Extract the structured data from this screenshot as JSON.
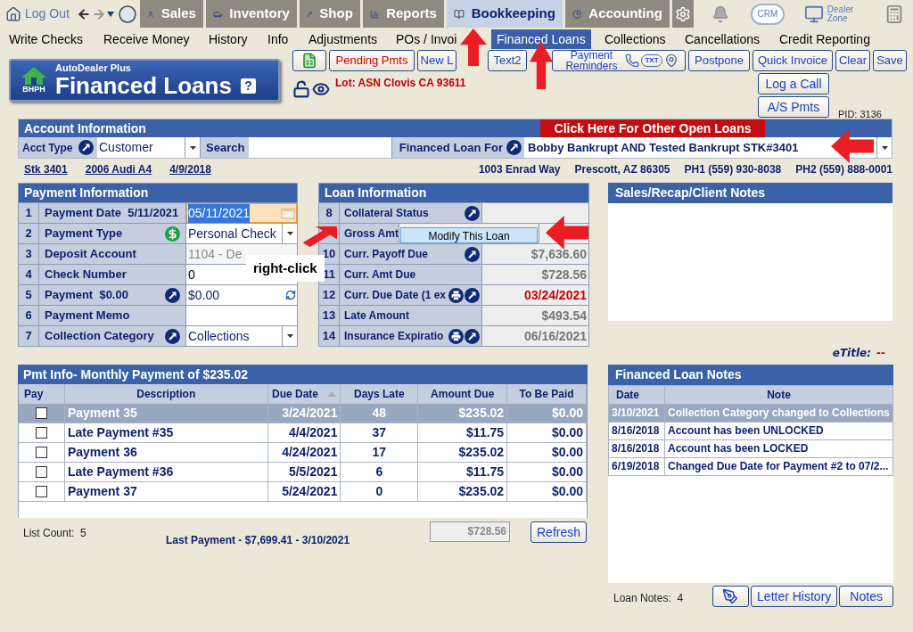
{
  "top_nav": {
    "logout": "Log Out",
    "modules": [
      {
        "label": "Sales",
        "selected": false
      },
      {
        "label": "Inventory",
        "selected": false
      },
      {
        "label": "Shop",
        "selected": false
      },
      {
        "label": "Reports",
        "selected": false
      },
      {
        "label": "Bookkeeping",
        "selected": true
      },
      {
        "label": "Accounting",
        "selected": false
      }
    ],
    "crm": "CRM",
    "dealer_zone": "Dealer Zone"
  },
  "sub_nav": [
    {
      "label": "Write Checks",
      "selected": false
    },
    {
      "label": "Receive Money",
      "selected": false
    },
    {
      "label": "History",
      "selected": false
    },
    {
      "label": "Info",
      "selected": false
    },
    {
      "label": "Adjustments",
      "selected": false
    },
    {
      "label": "POs / Invoi",
      "selected": false
    },
    {
      "label": "Financed Loans",
      "selected": true
    },
    {
      "label": "Collections",
      "selected": false
    },
    {
      "label": "Cancellations",
      "selected": false
    },
    {
      "label": "Credit Reporting",
      "selected": false
    }
  ],
  "header": {
    "brand": "AutoDealer Plus",
    "title": "Financed Loans",
    "help": "?",
    "logo_text": "BHPH",
    "lot": "Lot: ASN Clovis CA 93611"
  },
  "toolbar": [
    {
      "label": "Pending Pmts",
      "highlight": true
    },
    {
      "label": "New L",
      "highlight": false
    },
    {
      "label": "Text2",
      "highlight": false
    },
    {
      "label": "Payment Reminders",
      "highlight": false
    },
    {
      "label": "Postpone",
      "highlight": false
    },
    {
      "label": "Quick Invoice",
      "highlight": false
    },
    {
      "label": "Clear",
      "highlight": false
    },
    {
      "label": "Save",
      "highlight": false
    }
  ],
  "reminder_badge": "TXT",
  "side_buttons": [
    "Log a Call",
    "A/S Pmts"
  ],
  "pid": "PID: 3136",
  "account": {
    "title": "Account Information",
    "other_loans": "Click Here For Other Open Loans",
    "acct_type_label": "Acct Type",
    "acct_type": "Customer",
    "search_label": "Search",
    "financed_for_label": "Financed Loan For",
    "financed_for": "Bobby Bankrupt AND Tested Bankrupt STK#3401",
    "links": [
      "Stk 3401",
      "2006 Audi A4",
      "4/9/2018"
    ],
    "details": [
      "1003 Enrad Way",
      "Prescott, AZ 86305",
      "PH1 (559) 930-8038",
      "PH2 (559) 888-0001"
    ]
  },
  "payment_info": {
    "title": "Payment Information",
    "rows": [
      {
        "num": "1",
        "label": "Payment Date  5/11/2021",
        "value": "05/11/2021",
        "kind": "date",
        "focused": true
      },
      {
        "num": "2",
        "label": "Payment Type",
        "value": "Personal Check",
        "kind": "select"
      },
      {
        "num": "3",
        "label": "Deposit Account",
        "value": "1104 - De",
        "kind": "text",
        "disabled": true
      },
      {
        "num": "4",
        "label": "Check Number",
        "value": "0",
        "kind": "text"
      },
      {
        "num": "5",
        "label": "Payment  $0.00",
        "value": "$0.00",
        "kind": "refresh"
      },
      {
        "num": "6",
        "label": "Payment Memo",
        "kind": "text"
      },
      {
        "num": "7",
        "label": "Collection Category",
        "value": "Collections",
        "kind": "select"
      }
    ]
  },
  "loan_info": {
    "title": "Loan Information",
    "rows": [
      {
        "num": "8",
        "label": "Collateral Status"
      },
      {
        "num": "10",
        "label": "Curr. Payoff Due",
        "value": "$7,636.60",
        "alert": false
      },
      {
        "num": "11",
        "label": "Curr. Amt Due",
        "value": "$728.56",
        "alert": false
      },
      {
        "num": "12",
        "label": "Curr. Due Date (1 ex",
        "value": "03/24/2021",
        "alert": true
      },
      {
        "num": "13",
        "label": "Late Amount",
        "value": "$493.54",
        "alert": false
      },
      {
        "num": "14",
        "label": "Insurance Expiratio",
        "value": "06/16/2021",
        "alert": false
      }
    ],
    "gross_label": "Gross Amt"
  },
  "context_menu": {
    "items": [
      "Modify This Loan"
    ]
  },
  "callout": "right-click",
  "client_notes": {
    "title": "Sales/Recap/Client Notes"
  },
  "etitle": {
    "label": "eTitle:",
    "value": "--"
  },
  "payments": {
    "title": "Pmt Info- Monthly Payment of $235.02",
    "pay_column": "Pay",
    "columns": [
      {
        "label": "Description",
        "sorted": false
      },
      {
        "label": "Due Date",
        "sorted": true
      },
      {
        "label": "Days Late",
        "sorted": false
      },
      {
        "label": "Amount Due",
        "sorted": false
      },
      {
        "label": "To Be Paid",
        "sorted": false
      }
    ],
    "rows": [
      {
        "checked": false,
        "selected": true,
        "cells": [
          "Payment 35",
          "3/24/2021",
          "48",
          "$235.02",
          "$0.00"
        ]
      },
      {
        "checked": false,
        "selected": false,
        "cells": [
          "Late Payment #35",
          "4/4/2021",
          "37",
          "$11.75",
          "$0.00"
        ]
      },
      {
        "checked": false,
        "selected": false,
        "cells": [
          "Payment 36",
          "4/24/2021",
          "17",
          "$235.02",
          "$0.00"
        ]
      },
      {
        "checked": false,
        "selected": false,
        "cells": [
          "Late Payment #36",
          "5/5/2021",
          "6",
          "$11.75",
          "$0.00"
        ]
      },
      {
        "checked": false,
        "selected": false,
        "cells": [
          "Payment 37",
          "5/24/2021",
          "0",
          "$235.02",
          "$0.00"
        ]
      }
    ],
    "list_count": "List Count:  5",
    "last_payment": "Last Payment - $7,699.41 - 3/10/2021",
    "total": "$728.56",
    "refresh": "Refresh"
  },
  "notes": {
    "title": "Financed Loan Notes",
    "columns": [
      "Date",
      "Note"
    ],
    "rows": [
      {
        "date": "3/10/2021",
        "note": "Collection Category changed to Collections",
        "selected": true
      },
      {
        "date": "8/16/2018",
        "note": "Account has been UNLOCKED",
        "selected": false
      },
      {
        "date": "8/16/2018",
        "note": "Account has been LOCKED",
        "selected": false
      },
      {
        "date": "6/19/2018",
        "note": "Changed Due Date for Payment #2 to 07/2...",
        "selected": false
      }
    ],
    "count": "Loan Notes:  4",
    "buttons": [
      "Letter History",
      "Notes"
    ]
  }
}
